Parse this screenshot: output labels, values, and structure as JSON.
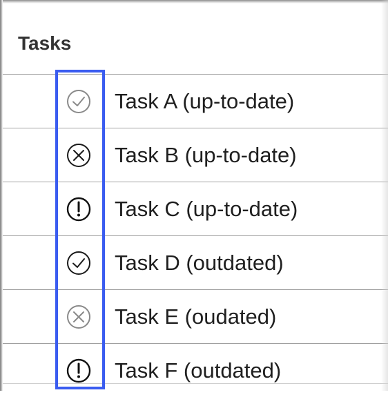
{
  "table": {
    "header": "Tasks",
    "rows": [
      {
        "label": "Task A (up-to-date)",
        "status_icon": "check-circle-icon",
        "icon_color": "#8a8a8a"
      },
      {
        "label": "Task B (up-to-date)",
        "status_icon": "x-circle-icon",
        "icon_color": "#1a1a1a"
      },
      {
        "label": "Task C (up-to-date)",
        "status_icon": "exclamation-circle-icon",
        "icon_color": "#111111"
      },
      {
        "label": "Task D (outdated)",
        "status_icon": "check-circle-icon",
        "icon_color": "#1a1a1a"
      },
      {
        "label": "Task E (oudated)",
        "status_icon": "x-circle-icon",
        "icon_color": "#8a8a8a"
      },
      {
        "label": "Task F (outdated)",
        "status_icon": "exclamation-circle-icon",
        "icon_color": "#111111"
      }
    ]
  },
  "highlight_color": "#3a5cf0"
}
